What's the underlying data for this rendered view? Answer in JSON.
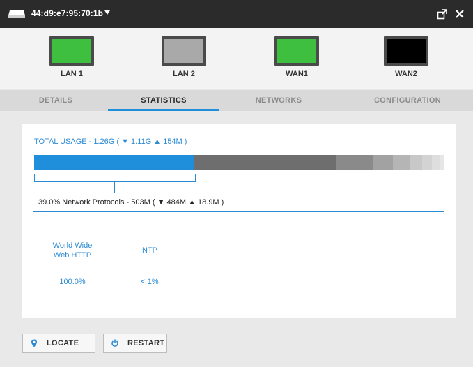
{
  "titlebar": {
    "device_label": "44:d9:e7:95:70:1b",
    "caret_icon": "caret-down-icon",
    "popout_icon": "popout-icon",
    "close_icon": "close-icon"
  },
  "ports": [
    {
      "label": "LAN 1",
      "status_color": "#3fbf3f"
    },
    {
      "label": "LAN 2",
      "status_color": "#a9a9a9"
    },
    {
      "label": "WAN1",
      "status_color": "#3fbf3f"
    },
    {
      "label": "WAN2",
      "status_color": "#000000"
    }
  ],
  "tabs": [
    {
      "label": "DETAILS",
      "active": false
    },
    {
      "label": "STATISTICS",
      "active": true
    },
    {
      "label": "NETWORKS",
      "active": false
    },
    {
      "label": "CONFIGURATION",
      "active": false
    }
  ],
  "usage": {
    "title": "TOTAL USAGE - 1.26G ( ▼ 1.11G ▲ 154M )",
    "segments": [
      {
        "fraction": 0.39,
        "color": "#1f8fdb"
      },
      {
        "fraction": 0.345,
        "color": "#6e6e6e"
      },
      {
        "fraction": 0.09,
        "color": "#8a8a8a"
      },
      {
        "fraction": 0.05,
        "color": "#a2a2a2"
      },
      {
        "fraction": 0.04,
        "color": "#b5b5b5"
      },
      {
        "fraction": 0.03,
        "color": "#c8c8c8"
      },
      {
        "fraction": 0.025,
        "color": "#d3d3d3"
      },
      {
        "fraction": 0.02,
        "color": "#dedede"
      },
      {
        "fraction": 0.01,
        "color": "#e6e6e6"
      }
    ],
    "selected_detail": "39.0% Network Protocols - 503M ( ▼ 484M ▲ 18.9M )",
    "protocols": [
      {
        "name_line1": "World Wide",
        "name_line2": "Web HTTP",
        "percent": "100.0%"
      },
      {
        "name_line1": "NTP",
        "name_line2": "",
        "percent": "< 1%"
      }
    ]
  },
  "buttons": {
    "locate": {
      "label": "LOCATE",
      "icon": "location-pin-icon"
    },
    "restart": {
      "label": "RESTART",
      "icon": "restart-icon"
    }
  },
  "colors": {
    "accent": "#1e8fd8",
    "titlebar": "#2b2b2b"
  }
}
